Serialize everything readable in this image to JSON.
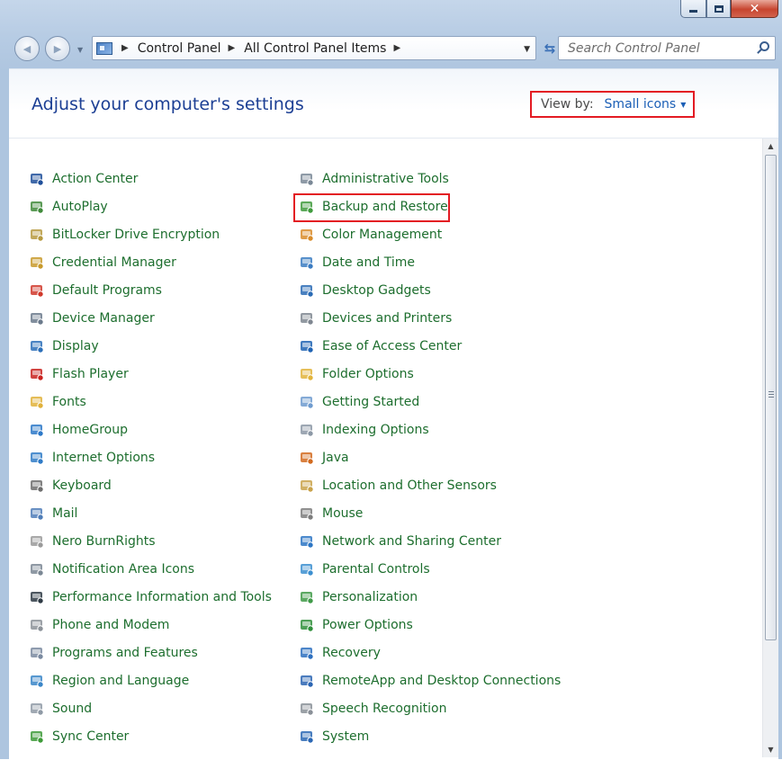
{
  "window": {
    "close_glyph": "✕"
  },
  "nav": {
    "back_glyph": "◀",
    "forward_glyph": "▶",
    "dropdown_glyph": "▼",
    "refresh_glyph": "⇆"
  },
  "address": {
    "crumbs": [
      "Control Panel",
      "All Control Panel Items"
    ],
    "separator": "▶"
  },
  "search": {
    "placeholder": "Search Control Panel"
  },
  "page": {
    "title": "Adjust your computer's settings"
  },
  "view_by": {
    "label": "View by:",
    "value": "Small icons"
  },
  "items_left": [
    {
      "label": "Action Center",
      "icon": "flag-icon",
      "color": "#1f4f9a"
    },
    {
      "label": "AutoPlay",
      "icon": "autoplay-icon",
      "color": "#3f8a3a"
    },
    {
      "label": "BitLocker Drive Encryption",
      "icon": "key-icon",
      "color": "#b79a3f"
    },
    {
      "label": "Credential Manager",
      "icon": "vault-icon",
      "color": "#c89a2c"
    },
    {
      "label": "Default Programs",
      "icon": "globe-check-icon",
      "color": "#d0382b"
    },
    {
      "label": "Device Manager",
      "icon": "printer-device-icon",
      "color": "#6b7a8c"
    },
    {
      "label": "Display",
      "icon": "monitor-icon",
      "color": "#2c6fb8"
    },
    {
      "label": "Flash Player",
      "icon": "flash-icon",
      "color": "#c9221f"
    },
    {
      "label": "Fonts",
      "icon": "folder-fonts-icon",
      "color": "#e0b13a"
    },
    {
      "label": "HomeGroup",
      "icon": "homegroup-icon",
      "color": "#2c78c8"
    },
    {
      "label": "Internet Options",
      "icon": "globe-icon",
      "color": "#2f7bc7"
    },
    {
      "label": "Keyboard",
      "icon": "keyboard-icon",
      "color": "#6d6d6d"
    },
    {
      "label": "Mail",
      "icon": "mail-icon",
      "color": "#4f7db8"
    },
    {
      "label": "Nero BurnRights",
      "icon": "disc-icon",
      "color": "#9a9a9a"
    },
    {
      "label": "Notification Area Icons",
      "icon": "tray-icon",
      "color": "#7b8794"
    },
    {
      "label": "Performance Information and Tools",
      "icon": "meter-icon",
      "color": "#2e3a44"
    },
    {
      "label": "Phone and Modem",
      "icon": "phone-icon",
      "color": "#8c9299"
    },
    {
      "label": "Programs and Features",
      "icon": "programs-icon",
      "color": "#7a8aa0"
    },
    {
      "label": "Region and Language",
      "icon": "globe-clock-icon",
      "color": "#3a86c8"
    },
    {
      "label": "Sound",
      "icon": "speaker-icon",
      "color": "#8f9aa6"
    },
    {
      "label": "Sync Center",
      "icon": "sync-icon",
      "color": "#3d9a38"
    }
  ],
  "items_right": [
    {
      "label": "Administrative Tools",
      "icon": "gears-icon",
      "color": "#7a8896"
    },
    {
      "label": "Backup and Restore",
      "icon": "backup-icon",
      "color": "#3f9a3c"
    },
    {
      "label": "Color Management",
      "icon": "color-monitor-icon",
      "color": "#d98c2a"
    },
    {
      "label": "Date and Time",
      "icon": "calendar-clock-icon",
      "color": "#3b7cc2"
    },
    {
      "label": "Desktop Gadgets",
      "icon": "gadgets-icon",
      "color": "#2a6bb5"
    },
    {
      "label": "Devices and Printers",
      "icon": "printer-icon",
      "color": "#7f8791"
    },
    {
      "label": "Ease of Access Center",
      "icon": "ease-access-icon",
      "color": "#1f63b3"
    },
    {
      "label": "Folder Options",
      "icon": "folder-options-icon",
      "color": "#e2b43c"
    },
    {
      "label": "Getting Started",
      "icon": "getting-started-icon",
      "color": "#6f9bcf"
    },
    {
      "label": "Indexing Options",
      "icon": "magnifier-icon",
      "color": "#8c98a6"
    },
    {
      "label": "Java",
      "icon": "java-icon",
      "color": "#d26a1f"
    },
    {
      "label": "Location and Other Sensors",
      "icon": "sensor-icon",
      "color": "#c9a24a"
    },
    {
      "label": "Mouse",
      "icon": "mouse-icon",
      "color": "#7d7d7d"
    },
    {
      "label": "Network and Sharing Center",
      "icon": "network-icon",
      "color": "#2d76c4"
    },
    {
      "label": "Parental Controls",
      "icon": "parental-icon",
      "color": "#3c8fd0"
    },
    {
      "label": "Personalization",
      "icon": "personalize-icon",
      "color": "#3f9a48"
    },
    {
      "label": "Power Options",
      "icon": "battery-icon",
      "color": "#2f8f3a"
    },
    {
      "label": "Recovery",
      "icon": "recovery-icon",
      "color": "#2d70c0"
    },
    {
      "label": "RemoteApp and Desktop Connections",
      "icon": "remote-icon",
      "color": "#2b65b3"
    },
    {
      "label": "Speech Recognition",
      "icon": "microphone-icon",
      "color": "#8a9098"
    },
    {
      "label": "System",
      "icon": "system-icon",
      "color": "#2a67b4"
    }
  ],
  "highlighted_item": "Backup and Restore",
  "colors": {
    "link": "#1d6e2e",
    "title": "#1c3f94",
    "highlight_border": "#e31b23",
    "view_value": "#1b5fb6"
  }
}
